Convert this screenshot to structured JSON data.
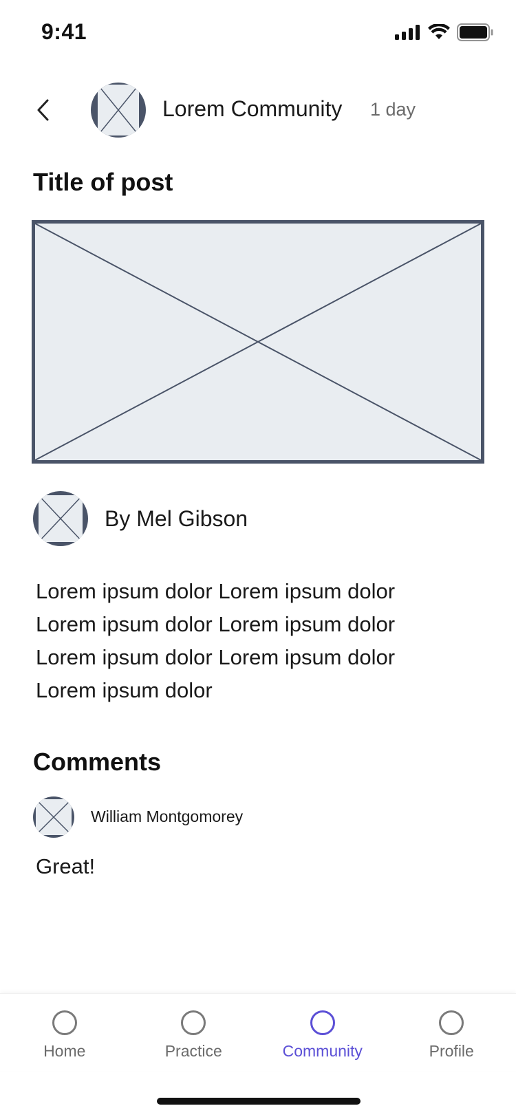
{
  "status_bar": {
    "time": "9:41",
    "icons": [
      "cellular-signal-icon",
      "wifi-icon",
      "battery-icon"
    ]
  },
  "header": {
    "back_icon": "chevron-left-icon",
    "community_name": "Lorem Community",
    "post_age": "1 day"
  },
  "post": {
    "title": "Title of post",
    "author": "By Mel Gibson",
    "body": "Lorem ipsum dolor Lorem ipsum dolor\nLorem ipsum dolor Lorem ipsum dolor\nLorem ipsum dolor Lorem ipsum dolor\nLorem ipsum dolor"
  },
  "comments": {
    "title": "Comments",
    "items": [
      {
        "author": "William Montgomorey",
        "text": "Great!"
      }
    ]
  },
  "tab_bar": {
    "tabs": [
      {
        "label": "Home",
        "active": false
      },
      {
        "label": "Practice",
        "active": false
      },
      {
        "label": "Community",
        "active": true
      },
      {
        "label": "Profile",
        "active": false
      }
    ]
  },
  "colors": {
    "accent": "#5b4fd6",
    "placeholder_fill": "#e9edf1",
    "placeholder_stroke": "#4a5468"
  }
}
